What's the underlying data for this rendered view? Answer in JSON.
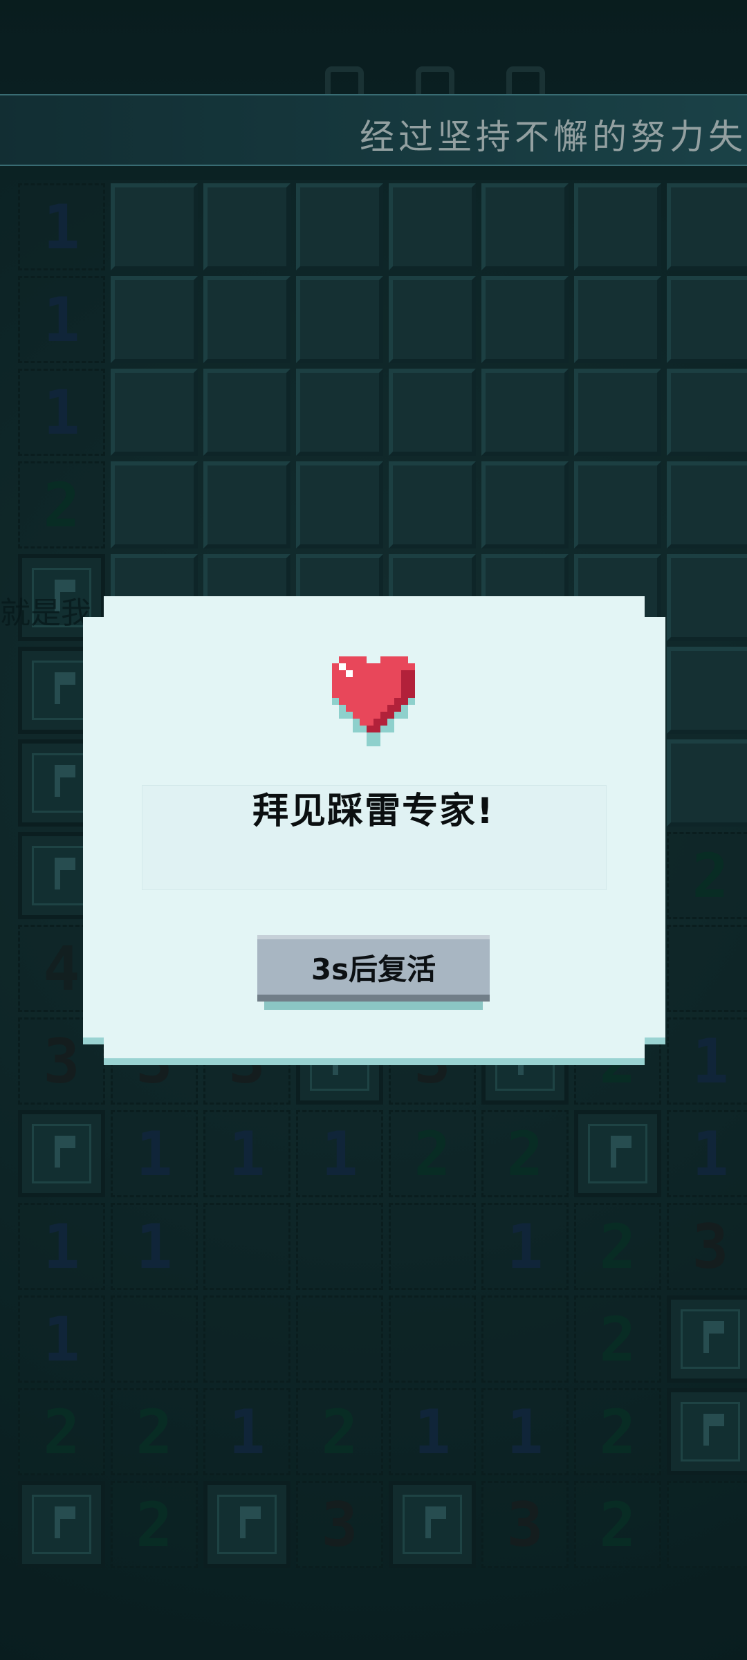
{
  "marquee": {
    "text": "经过坚持不懈的努力失"
  },
  "board": {
    "rows": [
      [
        "1",
        "T",
        "T",
        "T",
        "T",
        "T",
        "T",
        "T"
      ],
      [
        "1",
        "T",
        "T",
        "T",
        "T",
        "T",
        "T",
        "T"
      ],
      [
        "1",
        "T",
        "T",
        "T",
        "T",
        "T",
        "T",
        "T"
      ],
      [
        "2",
        "T",
        "T",
        "T",
        "T",
        "T",
        "T",
        "T"
      ],
      [
        "F",
        "T",
        "T",
        "T",
        "T",
        "T",
        "T",
        "T"
      ],
      [
        "F",
        "T",
        "T",
        "T",
        "T",
        "T",
        "T",
        "T"
      ],
      [
        "F",
        "T",
        "T",
        "T",
        "T",
        "T",
        "T",
        "T"
      ],
      [
        "F",
        "T",
        "T",
        "T",
        "T",
        "T",
        "T",
        "2"
      ],
      [
        "4",
        "",
        "",
        "",
        "",
        "",
        "",
        ""
      ],
      [
        "3",
        "3",
        "3",
        "F",
        "3",
        "F",
        "2",
        "1"
      ],
      [
        "F",
        "1",
        "1",
        "1",
        "2",
        "2",
        "F",
        "1"
      ],
      [
        "1",
        "1",
        "",
        "",
        "",
        "1",
        "2",
        "3"
      ],
      [
        "1",
        "",
        "",
        "",
        "",
        "",
        "2",
        "F"
      ],
      [
        "2",
        "2",
        "1",
        "2",
        "1",
        "1",
        "2",
        "F"
      ],
      [
        "F",
        "2",
        "F",
        "3",
        "F",
        "3",
        "2",
        ""
      ]
    ]
  },
  "dialog": {
    "title": "拜见踩雷专家!",
    "revive_label": "3s后复活",
    "heart_color": "#e8475a"
  },
  "side_text": "就是我"
}
